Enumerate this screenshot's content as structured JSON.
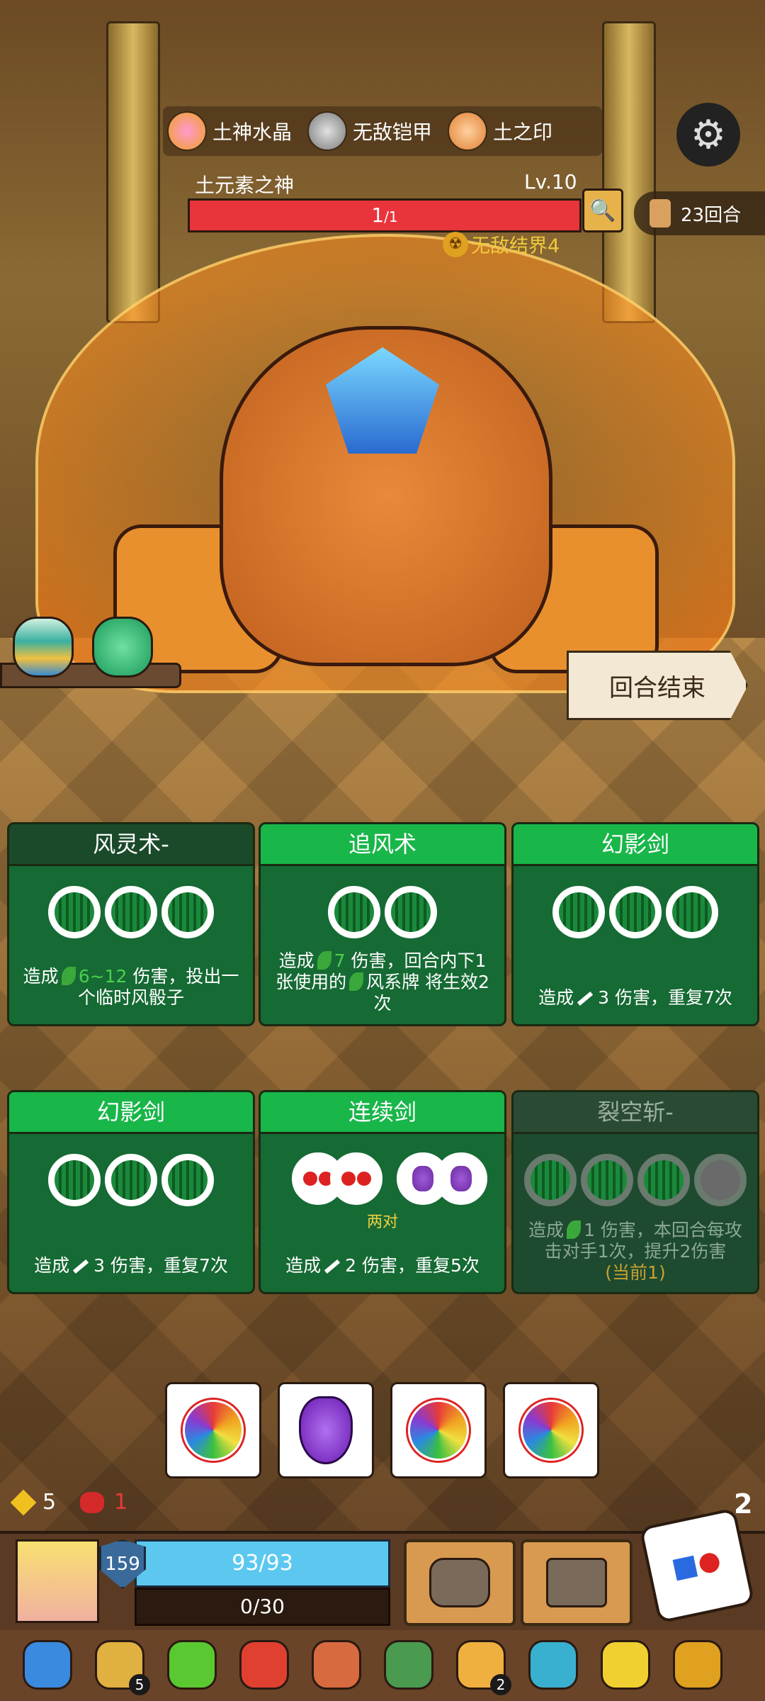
{
  "top_bar": {
    "resources": [
      {
        "icon": "earth-crystal-icon",
        "label": "土神水晶"
      },
      {
        "icon": "invincible-armor-icon",
        "label": "无敌铠甲"
      },
      {
        "icon": "earth-seal-icon",
        "label": "土之印"
      }
    ],
    "settings_icon": "gear-icon"
  },
  "boss": {
    "name": "土元素之神",
    "level": "Lv.10",
    "hp_current": "1",
    "hp_max": "/1",
    "status": "无敌结界4"
  },
  "turns": "23回合",
  "end_turn_label": "回合结束",
  "cards": [
    {
      "title": "风灵术-",
      "slots": 3,
      "desc_pre": "造成",
      "desc_value": "6~12",
      "desc_post": "伤害，投出一个临时风骰子"
    },
    {
      "title": "追风术",
      "slots": 2,
      "desc_pre": "造成",
      "desc_value": "7",
      "desc_mid": "伤害，回合内下1张使用的",
      "desc_post": "风系牌 将生效2次"
    },
    {
      "title": "幻影剑",
      "slots": 3,
      "desc_pre": "造成",
      "desc_value": "3",
      "desc_post": "伤害，重复7次"
    },
    {
      "title": "幻影剑",
      "slots": 3,
      "desc_pre": "造成",
      "desc_value": "3",
      "desc_post": "伤害，重复7次"
    },
    {
      "title": "连续剑",
      "pair_label": "两对",
      "desc_pre": "造成",
      "desc_value": "2",
      "desc_post": "伤害，重复5次"
    },
    {
      "title": "裂空斩-",
      "slots": 4,
      "desc_pre": "造成",
      "desc_value": "1",
      "desc_post": "伤害，本回合每攻击对手1次，提升2伤害",
      "desc_note": "(当前1)"
    }
  ],
  "dice": [
    {
      "face": "rainbow-swirl"
    },
    {
      "face": "grapes"
    },
    {
      "face": "rainbow-swirl"
    },
    {
      "face": "rainbow-swirl"
    }
  ],
  "player": {
    "energy": "5",
    "rage": "1",
    "hand_count": "2",
    "armor": "159",
    "hp": "93/93",
    "xp": "0/30"
  },
  "items": [
    {
      "icon": "moon-blade-icon",
      "count": ""
    },
    {
      "icon": "sapphire-ring-icon",
      "count": "5"
    },
    {
      "icon": "green-potion-icon",
      "count": ""
    },
    {
      "icon": "fire-sword-icon",
      "count": ""
    },
    {
      "icon": "meat-leg-icon",
      "count": ""
    },
    {
      "icon": "turtle-shell-icon",
      "count": ""
    },
    {
      "icon": "coin-bag-icon",
      "count": "2"
    },
    {
      "icon": "pumpkin-shield-icon",
      "count": ""
    },
    {
      "icon": "crown-icon",
      "count": ""
    },
    {
      "icon": "golden-cross-icon",
      "count": ""
    }
  ]
}
